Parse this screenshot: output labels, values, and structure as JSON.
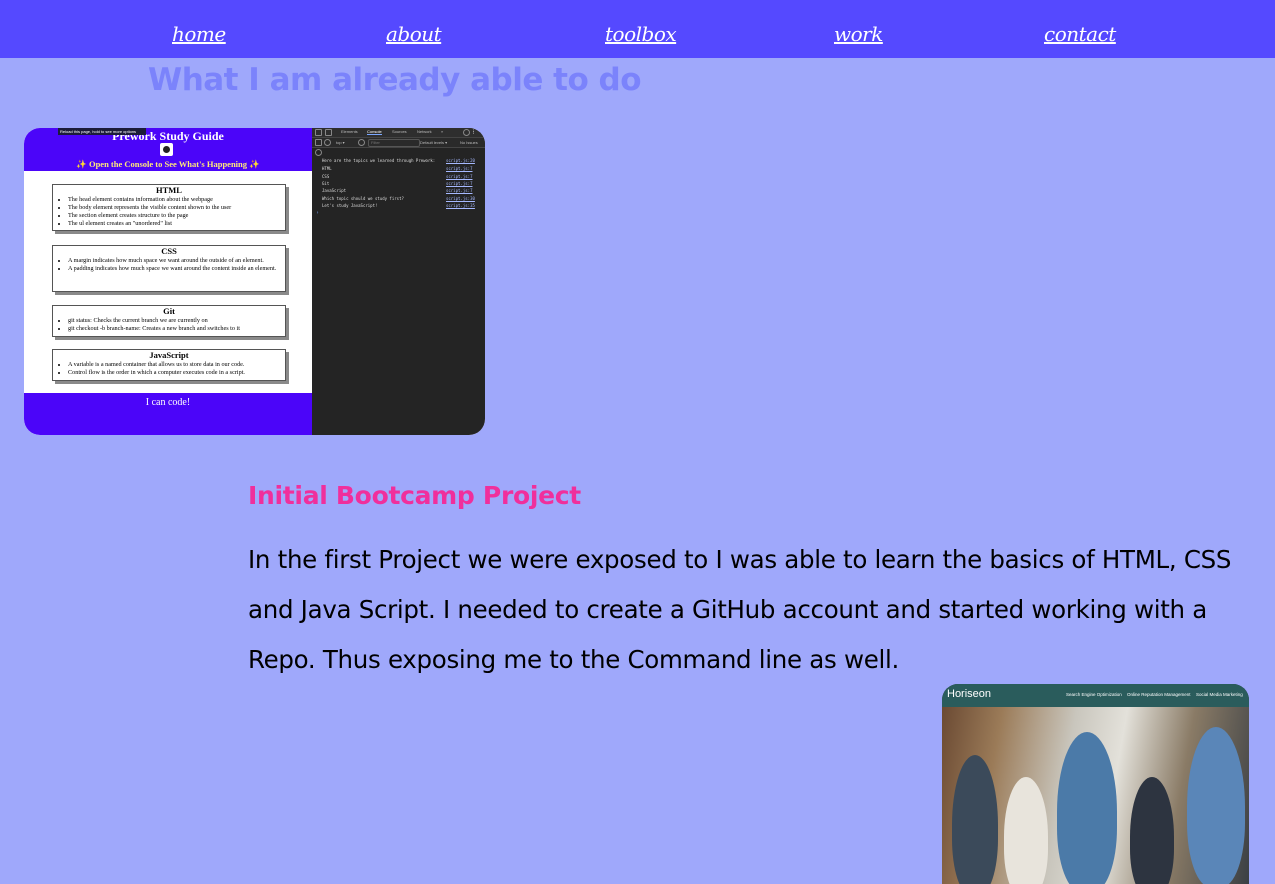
{
  "nav": {
    "items": [
      "home",
      "about",
      "toolbox",
      "work",
      "contact"
    ]
  },
  "section_heading": "What I am already able to do",
  "screenshot1": {
    "tooltip": "Reload this page, hold to see more options",
    "title": "Prework Study Guide",
    "subtitle": "✨ Open the Console to See What's Happening ✨",
    "cards": [
      {
        "heading": "HTML",
        "items": [
          "The head element contains information about the webpage",
          "The body element represents the visible content shown to the user",
          "The section element creates structure to the page",
          "The ul element creates an \"unordered\" list"
        ]
      },
      {
        "heading": "CSS",
        "items": [
          "A margin indicates how much space we want around the outside of an element.",
          "A padding indicates how much space we want around the content inside an element."
        ]
      },
      {
        "heading": "Git",
        "items": [
          "git status: Checks the current branch we are currently on",
          "git checkout -b branch-name: Creates a new branch and switches to it"
        ]
      },
      {
        "heading": "JavaScript",
        "items": [
          "A variable is a named container that allows us to store data in our code.",
          "Control flow is the order in which a computer executes code in a script."
        ]
      }
    ],
    "footer": "I can code!",
    "devtools": {
      "tabs": [
        "Elements",
        "Console",
        "Sources",
        "Network",
        "»"
      ],
      "context": "top ▾",
      "filter_placeholder": "Filter",
      "levels": "Default levels ▾",
      "issues": "No Issues",
      "log_lines": [
        {
          "text": "Here are the topics we learned through Prework:",
          "src": "script.js:20"
        },
        {
          "text": "HTML",
          "src": "script.js:7"
        },
        {
          "text": "CSS",
          "src": "script.js:7"
        },
        {
          "text": "Git",
          "src": "script.js:7"
        },
        {
          "text": "JavaScript",
          "src": "script.js:7"
        },
        {
          "text": "Which topic should we study first?",
          "src": "script.js:30"
        },
        {
          "text": "Let's study JavaScript!",
          "src": "script.js:35"
        }
      ]
    }
  },
  "project": {
    "heading": "Initial Bootcamp Project",
    "description": "In the first Project we were exposed to I was able to learn the basics of HTML, CSS and Java Script. I needed to create a GitHub account and started working with a Repo. Thus exposing me to the Command line as well."
  },
  "screenshot2": {
    "logo": "Horiseon",
    "links": [
      "Search Engine Optimization",
      "Online Reputation Management",
      "Social Media Marketing"
    ]
  },
  "colors": {
    "page_bg": "#9fa8fb",
    "nav_bg": "#5549ff",
    "heading_main": "#7b83fb",
    "heading_project": "#f02f9c"
  }
}
